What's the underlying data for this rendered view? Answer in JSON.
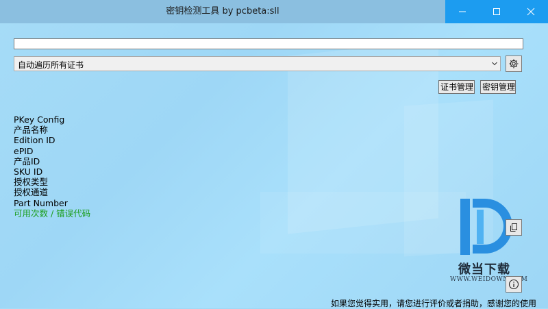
{
  "window": {
    "title": "密钥检测工具 by pcbeta:sll",
    "controls": [
      "minimize-icon",
      "maximize-icon",
      "close-icon"
    ],
    "accent_color": "#1c9cf0"
  },
  "key_input": {
    "value": ""
  },
  "combo": {
    "selected": "自动遍历所有证书"
  },
  "buttons": {
    "cert_manage": "证书管理",
    "key_manage": "密钥管理"
  },
  "info_lines": [
    "PKey Config",
    "产品名称",
    "Edition ID",
    "ePID",
    "产品ID",
    "SKU ID",
    "授权类型",
    "授权通道",
    "Part Number"
  ],
  "info_highlight": "可用次数 / 错误代码",
  "watermark": {
    "text": "微当下载",
    "url": "WWW.WEIDOWN.COM"
  },
  "footer": "如果您觉得实用，请您进行评价或者捐助，感谢您的使用",
  "icons": {
    "settings": "gear-icon",
    "copy": "copy-icon",
    "about": "info-icon",
    "dropdown": "chevron-down-icon"
  }
}
